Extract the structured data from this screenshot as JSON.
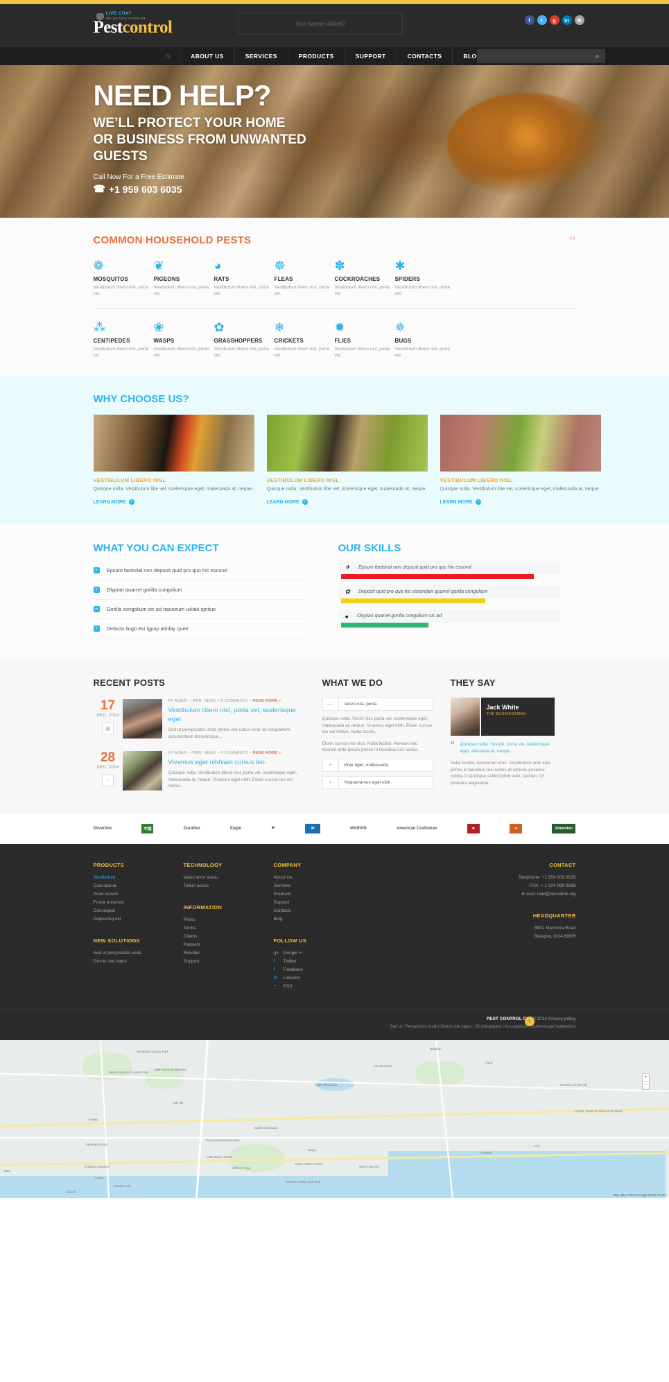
{
  "header": {
    "live_chat_title": "LIVE CHAT",
    "live_chat_sub": "We are here to help you",
    "logo_part1": "Pest",
    "logo_part2": "control",
    "banner_text": "Your banner 468x60",
    "socials": [
      {
        "name": "facebook",
        "glyph": "f"
      },
      {
        "name": "twitter",
        "glyph": "t"
      },
      {
        "name": "google-plus",
        "glyph": "g"
      },
      {
        "name": "linkedin",
        "glyph": "in"
      },
      {
        "name": "mail",
        "glyph": "✉"
      }
    ]
  },
  "nav": {
    "home_icon": "⌂",
    "items": [
      "ABOUT US",
      "SERVICES",
      "PRODUCTS",
      "SUPPORT",
      "CONTACTS",
      "BLOG"
    ],
    "search_placeholder": "",
    "search_icon": "⌕"
  },
  "hero": {
    "title": "NEED HELP?",
    "subtitle": "WE’LL PROTECT YOUR HOME OR BUSINESS FROM UNWANTED GUESTS",
    "call_label": "Call Now For a Free Estimate",
    "phone_icon": "☎",
    "phone": "+1 959 603 6035"
  },
  "pests": {
    "title": "COMMON HOUSEHOLD PESTS",
    "arrows": "‹›",
    "row1": [
      {
        "name": "MOSQUITOS",
        "desc": "Vestibulum libero nisl, porta vel.",
        "icon": "❁"
      },
      {
        "name": "PIGEONS",
        "desc": "Vestibulum libero nisl, porta vel.",
        "icon": "❦"
      },
      {
        "name": "RATS",
        "desc": "Vestibulum libero nisl, porta vel.",
        "icon": "◕"
      },
      {
        "name": "FLEAS",
        "desc": "Vestibulum libero nisl, porta vel.",
        "icon": "☸"
      },
      {
        "name": "COCKROACHES",
        "desc": "Vestibulum libero nisl, porta vel.",
        "icon": "✽"
      },
      {
        "name": "SPIDERS",
        "desc": "Vestibulum libero nisl, porta vel.",
        "icon": "✱"
      }
    ],
    "row2": [
      {
        "name": "CENTIPEDES",
        "desc": "Vestibulum libero nisl, porta vel.",
        "icon": "⁂"
      },
      {
        "name": "WASPS",
        "desc": "Vestibulum libero nisl, porta vel.",
        "icon": "❀"
      },
      {
        "name": "GRASSHOPPERS",
        "desc": "Vestibulum libero nisl, porta vel.",
        "icon": "✿"
      },
      {
        "name": "CRICKETS",
        "desc": "Vestibulum libero nisl, porta vel.",
        "icon": "❄"
      },
      {
        "name": "FLIES",
        "desc": "Vestibulum libero nisl, porta vel.",
        "icon": "✹"
      },
      {
        "name": "BUGS",
        "desc": "Vestibulum libero nisl, porta vel.",
        "icon": "✵"
      }
    ]
  },
  "why": {
    "title": "WHY CHOOSE US?",
    "cards": [
      {
        "heading": "VESTIBULUM LIBERO NISL",
        "text": "Quisque nulla. Vestibulum libe vel, scelerisque eget, malesuada at, neque.",
        "more": "LEARN MORE"
      },
      {
        "heading": "VESTIBULUM LIBERO NISL",
        "text": "Quisque nulla. Vestibulum libe vel, scelerisque eget, malesuada at, neque.",
        "more": "LEARN MORE"
      },
      {
        "heading": "VESTIBULUM LIBERO NISL",
        "text": "Quisque nulla. Vestibulum libe vel, scelerisque eget, malesuada at, neque.",
        "more": "LEARN MORE"
      }
    ]
  },
  "expect": {
    "title": "WHAT YOU CAN EXPECT",
    "items": [
      "Epsum factorial non deposit quid pro quo hic escorol",
      "Olypian quarrel  gorilla congolium",
      "Gorilla congolium sic ad nauseum uvlaki ignitus",
      "Defacto lingo est igpay atinlay quee"
    ]
  },
  "skills": {
    "title": "OUR SKILLS",
    "items": [
      {
        "icon": "✈",
        "label": "Epsum factorial non deposit quid pro quo hic escorol",
        "percent": 88,
        "color": "#ed1c24"
      },
      {
        "icon": "✿",
        "label": "Deposit quid pro quo hic escorolan quarrel  gorilla congolium",
        "percent": 66,
        "color": "#f7cf19"
      },
      {
        "icon": "●",
        "label": "Olypian quarrel  gorilla congolium sic ad",
        "percent": 40,
        "color": "#2bb673"
      }
    ]
  },
  "posts": {
    "title": "RECENT POSTS",
    "items": [
      {
        "day": "17",
        "month": "DEC, 2014",
        "icon": "▣",
        "meta_by": "BY ADMIN",
        "meta_cat": "WEB, NEWS",
        "meta_comments": "5 COMMENTS",
        "meta_more": "READ MORE »",
        "title": "Vestibulum libero nisl, porta vel, scelerisque eget.",
        "excerpt": "Sed ut perspiciatis unde omnis iste natus error sit voluptatem accusantium doloremque..."
      },
      {
        "day": "28",
        "month": "DEC, 2014",
        "icon": "□",
        "meta_by": "BY ADMIN",
        "meta_cat": "WEB, NEWS",
        "meta_comments": "5 COMMENTS",
        "meta_more": "READ MORE »",
        "title": "Vivamus eget nibhiam cursus leo.",
        "excerpt": "Quisque nulla. Vestibulum libero nisl, porta vel, scelerisque eget, malesuada at, neque. Vivamus eget nibh. Etiam cursus leo vel metus."
      }
    ]
  },
  "whatwedo": {
    "title": "WHAT WE DO",
    "open_row": {
      "mark": "—",
      "label": "Vesro nisl, porta."
    },
    "body1": "Quisque nulla. Vesro nisl, porta vel, scelerisque eget, malesuada at, neque. Vivamus eget nibh. Etiam cursus leo vel metus. Nulla facilisi.",
    "body2": "Etiam cursus leo vtus. Nulla facilisi. Aenean nec tibulum ante ipsum primis in faucibus orci luctus.",
    "rows": [
      {
        "mark": "+",
        "label": "Wue eget, malesuada."
      },
      {
        "mark": "+",
        "label": "Noquevamus eget nibh."
      }
    ]
  },
  "theysay": {
    "title": "THEY SAY",
    "name": "Jack White",
    "role": "THE BUSINESSMAN",
    "quote_mark": "“",
    "quote": "Quisque nulla. Vesnisl, porta vel, scelerisque eget, alesuada at, neque.",
    "text": "Nulla facilisi. Aeneanec eros. Vestibulum ante iute primis in faucibus orci luctus et ultrices posuere cubilia Cuandique sollicitudinb velit, sed leo. Ut pharetra augouque."
  },
  "brands": [
    {
      "name": "Silverline",
      "label": "Silverline",
      "color": "#2b4b7a"
    },
    {
      "name": "asian-brand",
      "label": "中国",
      "color": "#2f7d32"
    },
    {
      "name": "Duraflex",
      "label": "Duraflex",
      "color": "#b03030"
    },
    {
      "name": "Eagle",
      "label": "Eagle",
      "color": "#1f3f6e"
    },
    {
      "name": "crest-brand",
      "label": "⚑",
      "color": "#7a6a2e"
    },
    {
      "name": "blue-brand",
      "label": "W",
      "color": "#1f6fb0"
    },
    {
      "name": "MARVIN",
      "label": "MARVIN",
      "color": "#333333"
    },
    {
      "name": "American Craftsman",
      "label": "American Craftsman",
      "color": "#2b3a5a"
    },
    {
      "name": "red-brand",
      "label": "■",
      "color": "#b02020"
    },
    {
      "name": "orange-brand",
      "label": "●",
      "color": "#d06020"
    },
    {
      "name": "Simonton",
      "label": "Simonton",
      "color": "#2b5a2b"
    }
  ],
  "footer": {
    "col1": {
      "title": "PRODUCTS",
      "items": [
        "Vestibulum",
        "Cuis lacinia",
        "Proin dictum",
        "Fusce euismod",
        "Consequat",
        "Adipiscing elit"
      ],
      "title2": "NEW SOLUTIONS",
      "items2": [
        "Sed ut perspiciatis unde",
        "Omnis iste natus"
      ]
    },
    "col2": {
      "title": "TECHNOLOGY",
      "items": [
        "Vatus error sivolu",
        "Totem accus"
      ],
      "title2": "INFORMATION",
      "items2": [
        "Press",
        "Terms",
        "Clients",
        "Partners",
        "Reseller",
        "Support"
      ]
    },
    "col3": {
      "title": "COMPANY",
      "items": [
        "About Us",
        "Services",
        "Products",
        "Support",
        "Contacts",
        "Blog"
      ],
      "title2": "FOLLOW US",
      "socials": [
        {
          "icon": "g+",
          "label": "Google +"
        },
        {
          "icon": "t",
          "label": "Twitter"
        },
        {
          "icon": "f",
          "label": "Facebook"
        },
        {
          "icon": "in",
          "label": "LinkedIn"
        },
        {
          "icon": "◔",
          "label": "RSS"
        }
      ]
    },
    "col4": {
      "title": "CONTACT",
      "telephone_label": "Telephone:",
      "telephone": "+1 959 603 6035",
      "fax_label": "FAX:",
      "fax": "+ 1 504 889 9898",
      "email_label": "E-mail:",
      "email": "mail@demolink.org",
      "title2": "HEADQUARTER",
      "address1": "8901 Marmora Road",
      "address2": "Glasgow, DO4 89GR"
    },
    "copyright_brand": "PEST CONTROL CO.",
    "copyright_rest": "© 2014 Privacy policy",
    "bottom_links": "Sed ut | Perspiciatis unde | Omnis iste natus | Sit voluptatem | Accusantium | Doloremque laudantium",
    "gototop_icon": "↑"
  },
  "map": {
    "labels": [
      "Whitehall Country Park",
      "Belhus Woods Country Park",
      "Little Thurrock Marshes",
      "Orsett Heath",
      "Aveley",
      "South Ockendon",
      "Lake Alexandra",
      "Stifford Clays",
      "Chafford Hundred",
      "Grays",
      "West Thurrock",
      "Purfleet",
      "Thurrock Muset Services",
      "Little Dukes Wood",
      "Great Fathers Shaw",
      "Marshes Valley Golf Club",
      "Bulphan",
      "Horndon on the Hill",
      "Orsett, Orsett St Giles & All Saints",
      "Kenington Park",
      "A13",
      "A1306",
      "M25",
      "B1335",
      "A128",
      "Mill Hill",
      "Sandy's Hill"
    ],
    "credit": "Map data ©2014 Google   Terms of Use"
  }
}
